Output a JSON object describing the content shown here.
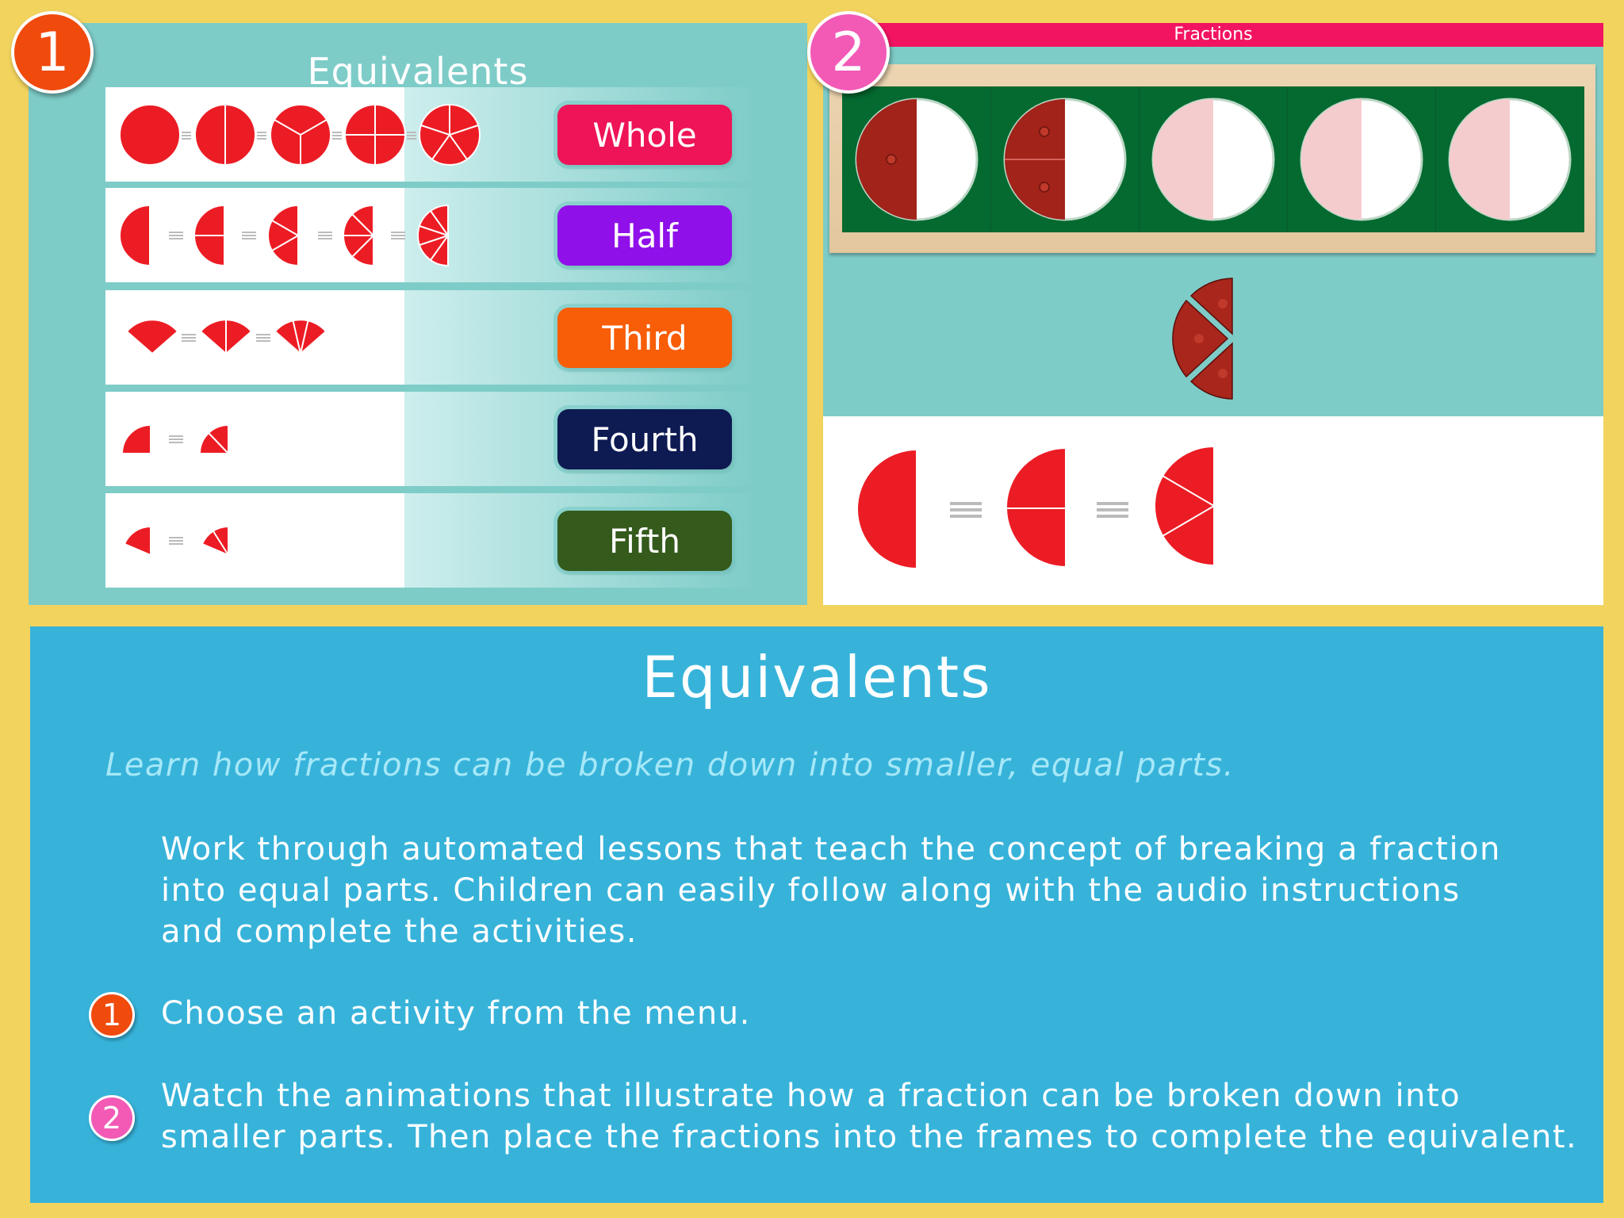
{
  "badges": {
    "one": "1",
    "two": "2"
  },
  "colors": {
    "background": "#F2D35E",
    "panel_teal": "#7ECCC8",
    "bottom_blue": "#37B3DA",
    "fraction_red": "#EC1C24",
    "badge_one": "#F04A0C",
    "badge_two": "#F25AB6",
    "fractions_bar": "#F31461"
  },
  "menu": {
    "title": "Equivalents",
    "items": [
      {
        "label": "Whole",
        "color": "#EE1457"
      },
      {
        "label": "Half",
        "color": "#9010EA"
      },
      {
        "label": "Third",
        "color": "#F85D07"
      },
      {
        "label": "Fourth",
        "color": "#0E1A52"
      },
      {
        "label": "Fifth",
        "color": "#345A1C"
      }
    ]
  },
  "activity": {
    "header": "Fractions",
    "frames": [
      {
        "state": "half filled"
      },
      {
        "state": "two quarters filled"
      },
      {
        "state": "empty"
      },
      {
        "state": "empty"
      },
      {
        "state": "empty"
      }
    ],
    "equation_equals_icon": "equivalence-icon"
  },
  "description": {
    "heading": "Equivalents",
    "subtitle": "Learn how fractions can be broken down into smaller, equal parts.",
    "body_lines": [
      "Work through automated lessons that teach the concept of breaking a fraction",
      "into equal parts. Children can easily follow along with the audio instructions",
      "and complete the activities."
    ],
    "steps": [
      {
        "number": "1",
        "lines": [
          "Choose an activity from the menu."
        ]
      },
      {
        "number": "2",
        "lines": [
          "Watch the animations that illustrate how a fraction can be broken down into",
          "smaller parts. Then place the fractions into the frames to complete the equivalent."
        ]
      }
    ]
  }
}
